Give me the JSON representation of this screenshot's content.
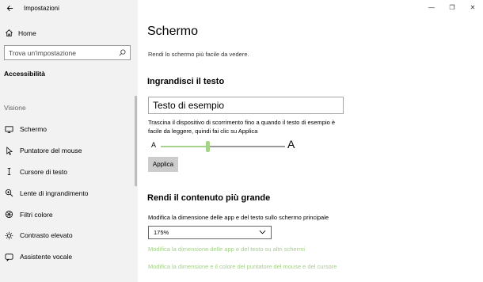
{
  "window": {
    "title": "Impostazioni",
    "controls": {
      "minimize": "—",
      "restore": "❐",
      "close": "✕"
    }
  },
  "sidebar": {
    "home_label": "Home",
    "search_placeholder": "Trova un'impostazione",
    "section_title": "Accessibilità",
    "group_label": "Visione",
    "items": [
      {
        "label": "Schermo",
        "icon": "monitor-icon"
      },
      {
        "label": "Puntatore del mouse",
        "icon": "pointer-icon"
      },
      {
        "label": "Cursore di testo",
        "icon": "text-cursor-icon"
      },
      {
        "label": "Lente di ingrandimento",
        "icon": "magnifier-icon"
      },
      {
        "label": "Filtri colore",
        "icon": "color-filter-icon"
      },
      {
        "label": "Contrasto elevato",
        "icon": "contrast-icon"
      },
      {
        "label": "Assistente vocale",
        "icon": "narrator-icon"
      }
    ]
  },
  "main": {
    "title": "Schermo",
    "subtitle": "Rendi lo schermo più facile da vedere.",
    "text_section": {
      "heading": "Ingrandisci il testo",
      "sample_text": "Testo di esempio",
      "description": "Trascina il dispositivo di scorrimento fino a quando il testo di esempio è facile da leggere, quindi fai clic su Applica",
      "slider_min_label": "A",
      "slider_max_label": "A",
      "slider_value": 0.38,
      "apply_label": "Applica"
    },
    "content_section": {
      "heading": "Rendi il contenuto più grande",
      "description": "Modifica la dimensione delle app e del testo sullo schermo principale",
      "scale_value": "175%",
      "link_1": "Modifica la dimensione delle app e del testo su altri schermi",
      "link_2": "Modifica la dimensione e il colore del puntatore del mouse e del cursore"
    }
  },
  "colors": {
    "accent": "#a6d38a",
    "sidebar_bg": "#f2f2f2"
  }
}
